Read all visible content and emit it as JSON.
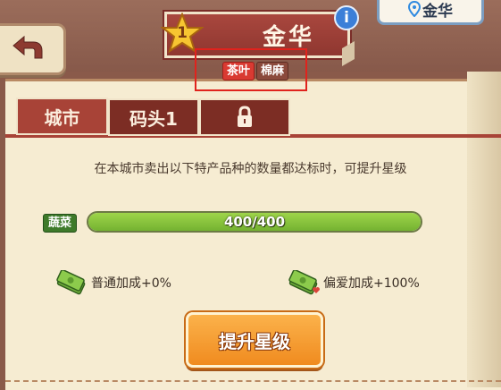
{
  "header": {
    "city_name": "金华",
    "star_level": "1",
    "location_label": "金华",
    "info_label": "i"
  },
  "tags": [
    "茶叶",
    "棉麻"
  ],
  "tabs": [
    {
      "label": "城市",
      "active": true
    },
    {
      "label": "码头1",
      "active": false
    },
    {
      "label": "",
      "locked": true
    }
  ],
  "description": "在本城市卖出以下特产品种的数量都达标时，可提升星级",
  "progress": {
    "category": "蔬菜",
    "text": "400/400",
    "fraction": 1.0
  },
  "bonuses": {
    "normal": "普通加成+0%",
    "preferred": "偏爱加成+100%"
  },
  "upgrade_button": "提升星级",
  "colors": {
    "banner": "#9d3e35",
    "progress_fill": "#86c33c",
    "button": "#f59a2c",
    "highlight_box": "#e0231d"
  }
}
